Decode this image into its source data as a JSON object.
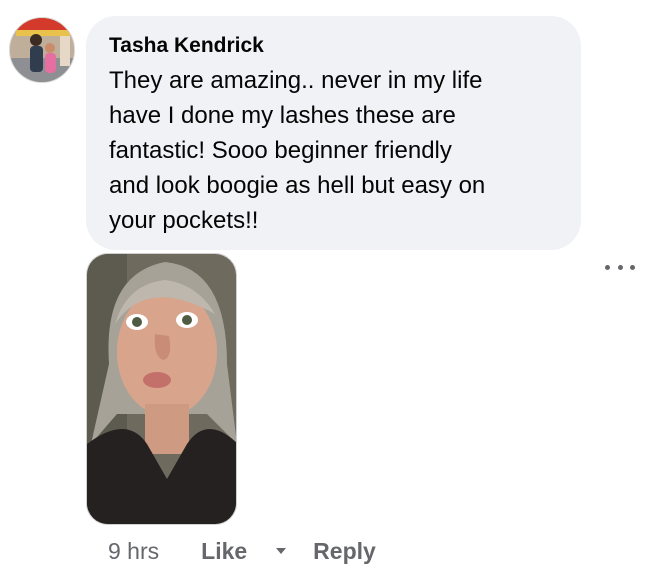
{
  "comment": {
    "author": "Tasha Kendrick",
    "body_lines": [
      "They are amazing.. never in my life",
      "have I done my lashes these are",
      "fantastic! Sooo beginner friendly",
      "and look boogie as hell but easy on",
      "your pockets!!"
    ],
    "timestamp": "9 hrs",
    "like_label": "Like",
    "reply_label": "Reply",
    "more_icon": "more-horizontal-icon",
    "reaction_caret_icon": "chevron-down-icon"
  },
  "colors": {
    "bubble_background": "#f0f2f5",
    "text_primary": "#050505",
    "text_secondary": "#65676b"
  }
}
